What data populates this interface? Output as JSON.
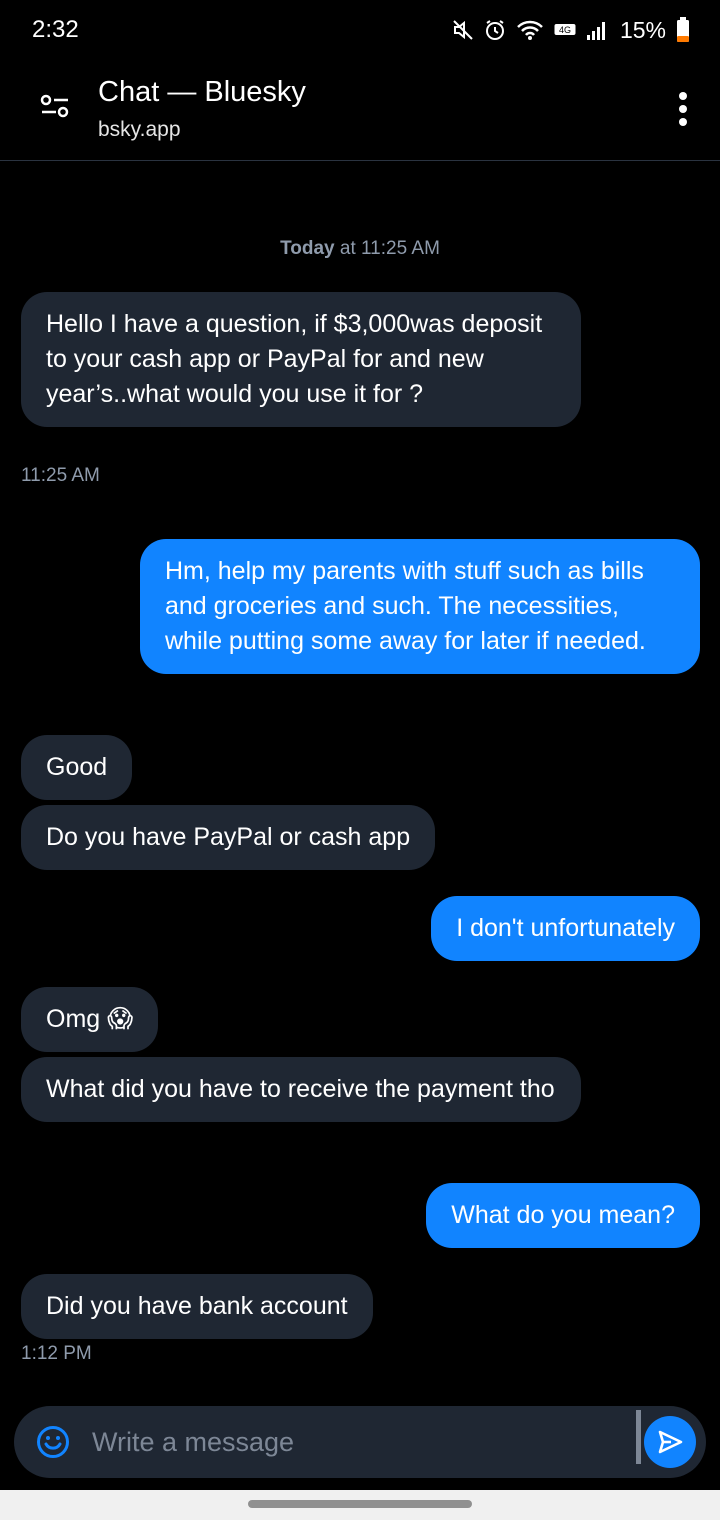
{
  "status_bar": {
    "time": "2:32",
    "network_badge": "4G",
    "battery": "15%",
    "battery_color": "#ff7a00"
  },
  "header": {
    "title": "Chat — Bluesky",
    "url": "bsky.app",
    "left_icon": "tune-icon",
    "right_icon": "more-vertical-icon"
  },
  "chat": {
    "day_separator": {
      "day": "Today",
      "rest": " at 11:25 AM"
    },
    "messages": [
      {
        "from": "them",
        "text": "Hello I have a question, if $3,000was deposit to your cash app or PayPal for and new year’s..what would you use it for ?",
        "time": "11:25 AM"
      },
      {
        "from": "me",
        "text": "Hm, help my parents with stuff such as bills and groceries and such. The necessities, while putting some away for later if needed."
      },
      {
        "from": "them",
        "text": "Good"
      },
      {
        "from": "them",
        "text": "Do you have PayPal or cash app"
      },
      {
        "from": "me",
        "text": "I don't unfortunately"
      },
      {
        "from": "them",
        "text": "Omg 😱"
      },
      {
        "from": "them",
        "text": "What did you have to receive the payment tho"
      },
      {
        "from": "me",
        "text": "What do you mean?"
      },
      {
        "from": "them",
        "text": "Did you have bank account",
        "time": "1:12 PM"
      }
    ]
  },
  "composer": {
    "placeholder": "Write a message",
    "value": ""
  },
  "colors": {
    "background": "#000000",
    "incoming_bubble": "#1f2733",
    "outgoing_bubble": "#1184ff",
    "muted_text": "#8f9bac"
  }
}
